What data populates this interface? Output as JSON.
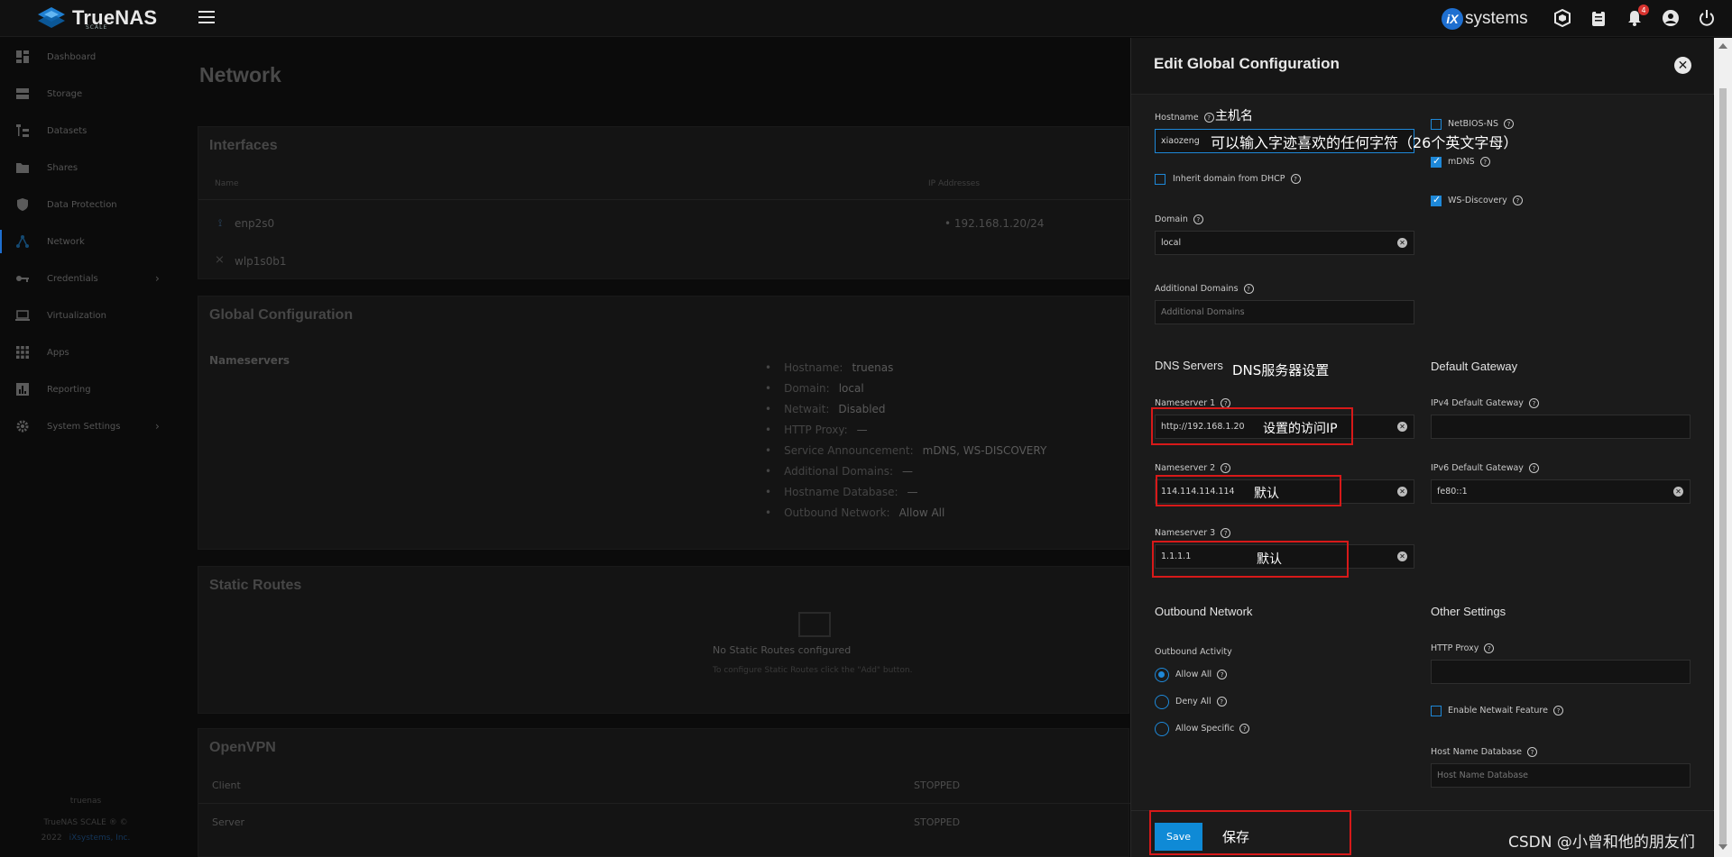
{
  "topbar": {
    "logo_text": "TrueNAS",
    "logo_sub": "SCALE",
    "brand": "systems",
    "brand_badge": "iX",
    "notification_count": "4"
  },
  "sidebar": {
    "items": [
      {
        "label": "Dashboard",
        "icon": "dashboard-icon"
      },
      {
        "label": "Storage",
        "icon": "storage-icon"
      },
      {
        "label": "Datasets",
        "icon": "datasets-icon"
      },
      {
        "label": "Shares",
        "icon": "shares-icon"
      },
      {
        "label": "Data Protection",
        "icon": "shield-icon"
      },
      {
        "label": "Network",
        "icon": "network-icon"
      },
      {
        "label": "Credentials",
        "icon": "key-icon"
      },
      {
        "label": "Virtualization",
        "icon": "laptop-icon"
      },
      {
        "label": "Apps",
        "icon": "apps-icon"
      },
      {
        "label": "Reporting",
        "icon": "reporting-icon"
      },
      {
        "label": "System Settings",
        "icon": "gear-icon"
      }
    ],
    "footer_host": "truenas",
    "footer_version": "TrueNAS SCALE ® ©",
    "footer_year": "2022",
    "footer_company": "iXsystems, Inc."
  },
  "page": {
    "title": "Network",
    "interfaces": {
      "title": "Interfaces",
      "col_name": "Name",
      "col_ip": "IP Addresses",
      "rows": [
        {
          "name": "enp2s0",
          "ip": "192.168.1.20/24"
        },
        {
          "name": "wlp1s0b1",
          "ip": ""
        }
      ]
    },
    "global_config": {
      "title": "Global Configuration",
      "nameservers_label": "Nameservers",
      "items": [
        {
          "k": "Hostname:",
          "v": "truenas"
        },
        {
          "k": "Domain:",
          "v": "local"
        },
        {
          "k": "Netwait:",
          "v": "Disabled"
        },
        {
          "k": "HTTP Proxy:",
          "v": "—"
        },
        {
          "k": "Service Announcement:",
          "v": "mDNS, WS-DISCOVERY"
        },
        {
          "k": "Additional Domains:",
          "v": "—"
        },
        {
          "k": "Hostname Database:",
          "v": "—"
        },
        {
          "k": "Outbound Network:",
          "v": "Allow All"
        }
      ]
    },
    "static_routes": {
      "title": "Static Routes",
      "empty": "No Static Routes configured",
      "hint": "To configure Static Routes click the \"Add\" button."
    },
    "openvpn": {
      "title": "OpenVPN",
      "rows": [
        {
          "name": "Client",
          "status": "STOPPED"
        },
        {
          "name": "Server",
          "status": "STOPPED"
        }
      ]
    }
  },
  "panel": {
    "title": "Edit Global Configuration",
    "hostname_label": "Hostname",
    "hostname_value": "xiaozeng",
    "inherit_label": "Inherit domain from DHCP",
    "domain_label": "Domain",
    "domain_value": "local",
    "additional_label": "Additional Domains",
    "additional_placeholder": "Additional Domains",
    "netbios_label": "NetBIOS-NS",
    "mdns_label": "mDNS",
    "wsd_label": "WS-Discovery",
    "dns_title": "DNS Servers",
    "ns1_label": "Nameserver 1",
    "ns1_value": "http://192.168.1.20",
    "ns2_label": "Nameserver 2",
    "ns2_value": "114.114.114.114",
    "ns3_label": "Nameserver 3",
    "ns3_value": "1.1.1.1",
    "gw_title": "Default Gateway",
    "ipv4_label": "IPv4 Default Gateway",
    "ipv6_label": "IPv6 Default Gateway",
    "ipv6_value": "fe80::1",
    "outbound_title": "Outbound Network",
    "outbound_activity": "Outbound Activity",
    "allow_all": "Allow All",
    "deny_all": "Deny All",
    "allow_specific": "Allow Specific",
    "other_title": "Other Settings",
    "http_proxy_label": "HTTP Proxy",
    "netwait_label": "Enable Netwait Feature",
    "hostdb_label": "Host Name Database",
    "hostdb_placeholder": "Host Name Database",
    "save_label": "Save"
  },
  "annotations": {
    "hostname": "主机名",
    "hostname_hint": "可以输入字迹喜欢的任何字符（26个英文字母）",
    "dns": "DNS服务器设置",
    "ns1": "设置的访问IP",
    "ns2": "默认",
    "ns3": "默认",
    "save": "保存"
  },
  "watermark": "CSDN @小曾和他的朋友们",
  "colors": {
    "accent": "#1e88d8",
    "annotation_box": "#d71919"
  }
}
